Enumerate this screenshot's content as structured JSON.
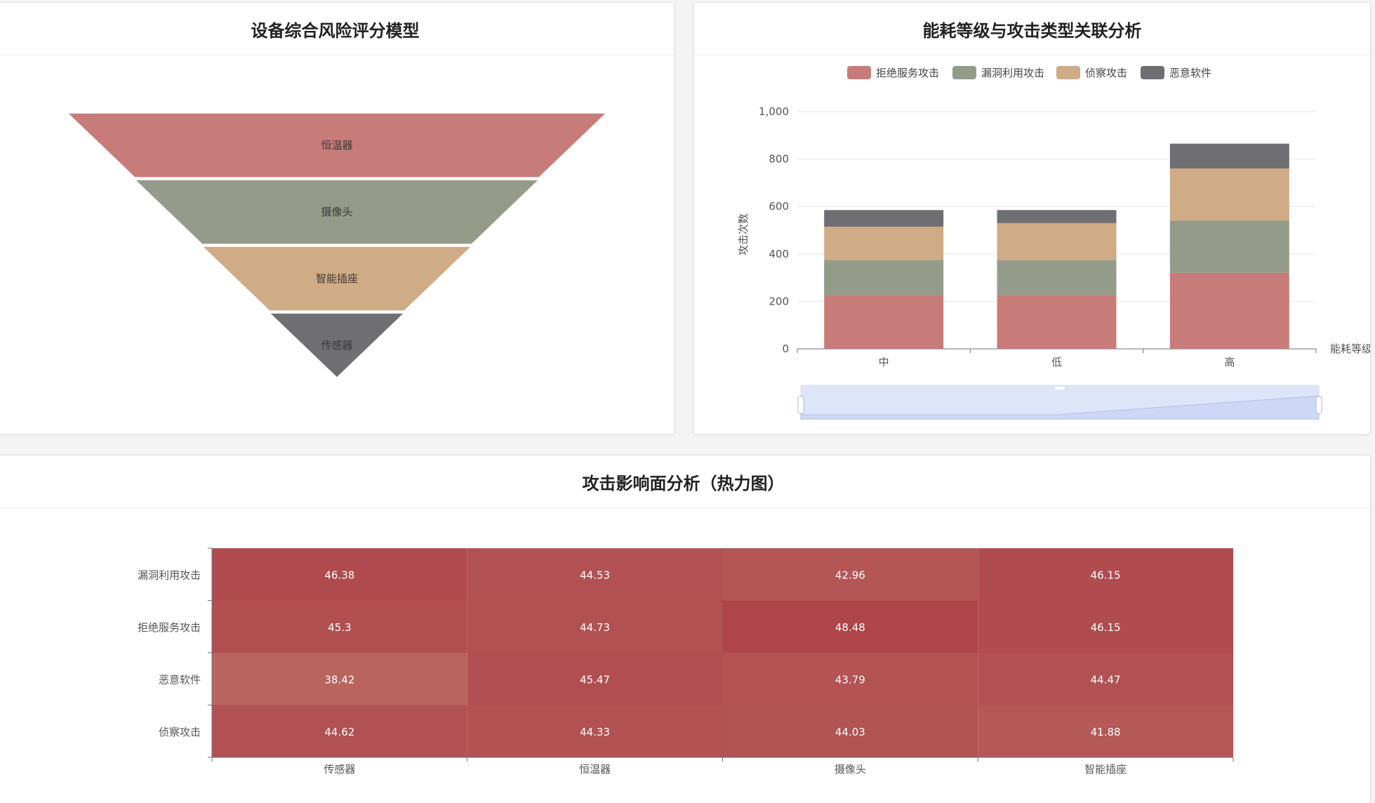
{
  "funnel_panel": {
    "title": "设备综合风险评分模型"
  },
  "stack_panel": {
    "title": "能耗等级与攻击类型关联分析"
  },
  "heatmap_panel": {
    "title": "攻击影响面分析（热力图）"
  },
  "colors": {
    "denial_of_service": "#c77c79",
    "exploit": "#949b89",
    "recon": "#cfab86",
    "malware": "#6f6f73",
    "heat_low": "#b9645f",
    "heat_high": "#ad454b"
  },
  "chart_data": [
    {
      "type": "funnel",
      "title": "设备综合风险评分模型",
      "categories": [
        "恒温器",
        "摄像头",
        "智能插座",
        "传感器"
      ],
      "colors": [
        "#c77c79",
        "#949b89",
        "#cfab86",
        "#6f6f73"
      ]
    },
    {
      "type": "bar",
      "stacked": true,
      "title": "能耗等级与攻击类型关联分析",
      "categories": [
        "中",
        "低",
        "高"
      ],
      "xlabel": "能耗等级",
      "ylabel": "攻击次数",
      "ylim": [
        0,
        1000
      ],
      "yticks": [
        "0",
        "200",
        "400",
        "600",
        "800",
        "1,000"
      ],
      "legend_position": "top",
      "data_zoom": true,
      "series": [
        {
          "name": "拒绝服务攻击",
          "color": "#c77c79",
          "values": [
            225,
            225,
            320
          ]
        },
        {
          "name": "漏洞利用攻击",
          "color": "#949b89",
          "values": [
            150,
            150,
            220
          ]
        },
        {
          "name": "侦察攻击",
          "color": "#cfab86",
          "values": [
            140,
            155,
            220
          ]
        },
        {
          "name": "恶意软件",
          "color": "#6f6f73",
          "values": [
            70,
            55,
            105
          ]
        }
      ]
    },
    {
      "type": "heatmap",
      "title": "攻击影响面分析（热力图）",
      "x": [
        "传感器",
        "恒温器",
        "摄像头",
        "智能插座"
      ],
      "y": [
        "漏洞利用攻击",
        "拒绝服务攻击",
        "恶意软件",
        "侦察攻击"
      ],
      "values": [
        [
          "46.38",
          "44.53",
          "42.96",
          "46.15"
        ],
        [
          "45.3",
          "44.73",
          "48.48",
          "46.15"
        ],
        [
          "38.42",
          "45.47",
          "43.79",
          "44.47"
        ],
        [
          "44.62",
          "44.33",
          "44.03",
          "41.88"
        ]
      ]
    }
  ]
}
